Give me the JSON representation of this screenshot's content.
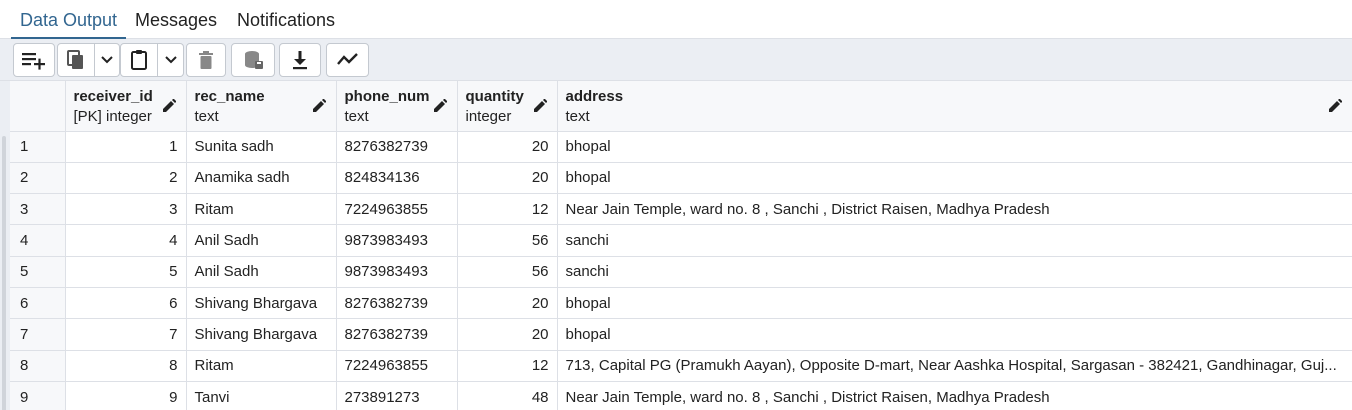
{
  "tabs": [
    {
      "label": "Data Output",
      "active": true
    },
    {
      "label": "Messages",
      "active": false
    },
    {
      "label": "Notifications",
      "active": false
    }
  ],
  "toolbar": {
    "buttons": [
      {
        "icon": "add-row-icon"
      },
      {
        "icon": "copy-icon"
      },
      {
        "icon": "chevron-down-icon"
      },
      {
        "icon": "paste-icon"
      },
      {
        "icon": "chevron-down-icon"
      },
      {
        "icon": "delete-icon"
      },
      {
        "icon": "save-data-icon"
      },
      {
        "icon": "download-icon"
      },
      {
        "icon": "graph-visualiser-icon"
      }
    ]
  },
  "columns": [
    {
      "name": "",
      "type": ""
    },
    {
      "name": "receiver_id",
      "type": "[PK] integer"
    },
    {
      "name": "rec_name",
      "type": "text"
    },
    {
      "name": "phone_num",
      "type": "text"
    },
    {
      "name": "quantity",
      "type": "integer"
    },
    {
      "name": "address",
      "type": "text"
    }
  ],
  "rows": [
    [
      "1",
      "1",
      "Sunita sadh",
      "8276382739",
      "20",
      "bhopal"
    ],
    [
      "2",
      "2",
      "Anamika sadh",
      "824834136",
      "20",
      "bhopal"
    ],
    [
      "3",
      "3",
      "Ritam",
      "7224963855",
      "12",
      "Near Jain Temple, ward no. 8 , Sanchi , District Raisen, Madhya Pradesh"
    ],
    [
      "4",
      "4",
      "Anil Sadh",
      "9873983493",
      "56",
      "sanchi"
    ],
    [
      "5",
      "5",
      "Anil Sadh",
      "9873983493",
      "56",
      "sanchi"
    ],
    [
      "6",
      "6",
      "Shivang Bhargava",
      "8276382739",
      "20",
      "bhopal"
    ],
    [
      "7",
      "7",
      "Shivang Bhargava",
      "8276382739",
      "20",
      "bhopal"
    ],
    [
      "8",
      "8",
      "Ritam",
      "7224963855",
      "12",
      "713, Capital PG (Pramukh Aayan), Opposite D-mart, Near Aashka Hospital, Sargasan - 382421, Gandhinagar, Guj..."
    ],
    [
      "9",
      "9",
      "Tanvi",
      "273891273",
      "48",
      "Near Jain Temple, ward no. 8 , Sanchi , District Raisen, Madhya Pradesh"
    ]
  ],
  "colors": {
    "accent": "#326690",
    "toolbar_bg": "#ebeef3",
    "border": "#dde0e6"
  }
}
